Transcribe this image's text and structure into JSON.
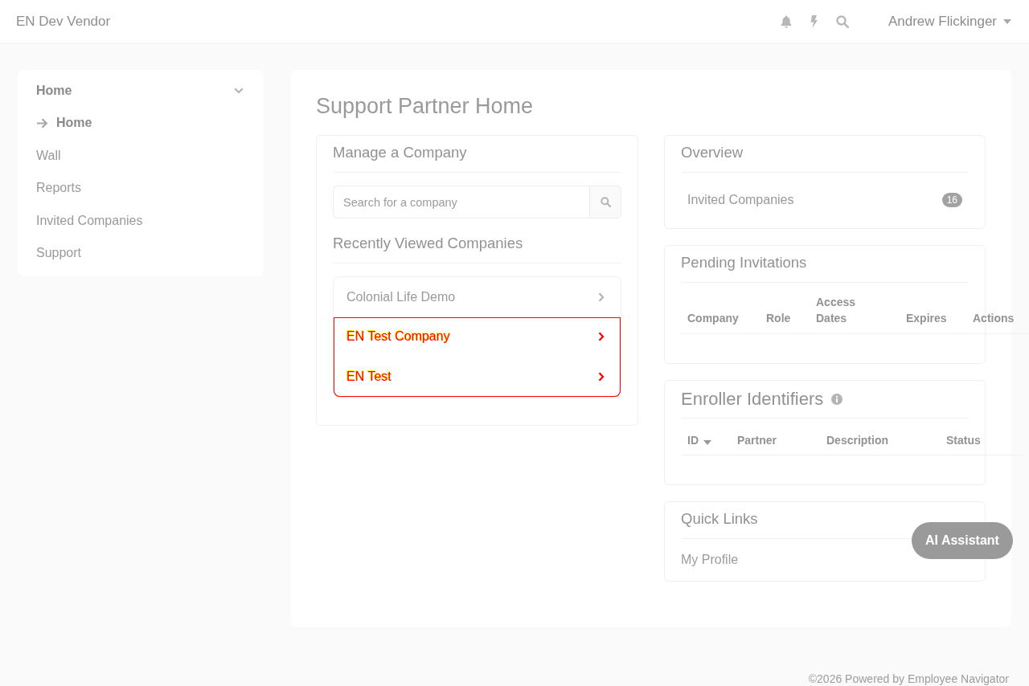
{
  "header": {
    "brand": "EN Dev Vendor",
    "user": "Andrew Flickinger"
  },
  "sidebar": {
    "items": [
      {
        "kind": "group",
        "label": "Home",
        "expanded": true,
        "children": [
          {
            "label": "Home",
            "selected": true
          }
        ]
      },
      {
        "kind": "link",
        "label": "Wall",
        "selected": false
      },
      {
        "kind": "link",
        "label": "Reports",
        "selected": false
      },
      {
        "kind": "link",
        "label": "Invited Companies",
        "selected": false
      },
      {
        "kind": "link",
        "label": "Support",
        "selected": false
      }
    ]
  },
  "main": {
    "title": "Support Partner Home",
    "manage_company": {
      "title": "Manage a Company",
      "search": {
        "placeholder": "Search for a company"
      },
      "recent_title": "Recently Viewed Companies",
      "recent_companies": [
        {
          "name": "Colonial Life Demo",
          "highlighted": false
        },
        {
          "name": "EN Test Company",
          "highlighted": true
        },
        {
          "name": "EN Test",
          "highlighted": true
        }
      ]
    },
    "overview": {
      "title": "Overview",
      "items": [
        {
          "label": "Invited Companies",
          "count": "16"
        }
      ]
    },
    "pending_invitations": {
      "title": "Pending Invitations",
      "columns": [
        {
          "label": "Company",
          "sorted": false
        },
        {
          "label": "Role",
          "sorted": false
        },
        {
          "label": "Access Dates",
          "sorted": false
        },
        {
          "label": "Expires",
          "sorted": false
        },
        {
          "label": "Actions",
          "sorted": false
        }
      ]
    },
    "enroller_identifiers": {
      "title": "Enroller Identifiers",
      "columns": [
        {
          "label": "ID",
          "sorted": true
        },
        {
          "label": "Partner",
          "sorted": false
        },
        {
          "label": "Description",
          "sorted": false
        },
        {
          "label": "Status",
          "sorted": false
        }
      ]
    },
    "quick_links": {
      "title": "Quick Links",
      "links": [
        "My Profile"
      ]
    }
  },
  "ai_assistant": {
    "label": "AI Assistant"
  },
  "footer": "©2026 Powered by Employee Navigator"
}
